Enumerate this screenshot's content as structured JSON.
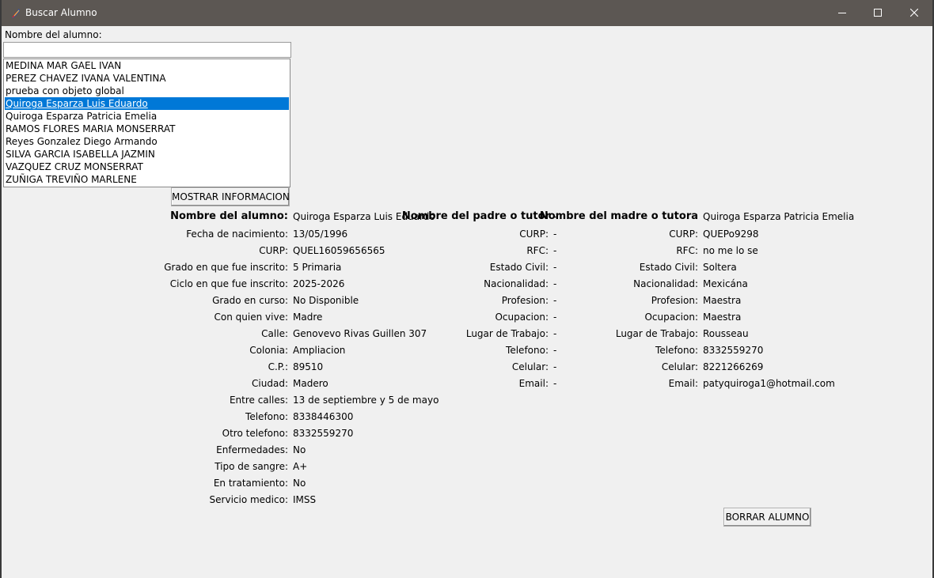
{
  "window": {
    "title": "Buscar Alumno",
    "minimize_icon": "minimize-icon",
    "maximize_icon": "maximize-icon",
    "close_icon": "close-icon",
    "app_icon": "feather-app-icon"
  },
  "search": {
    "label": "Nombre del alumno:",
    "value": ""
  },
  "student_list": {
    "items": [
      "MEDINA MAR GAEL IVAN",
      "PEREZ CHAVEZ IVANA VALENTINA",
      "prueba con objeto global",
      "Quiroga Esparza Luis Eduardo",
      "Quiroga Esparza Patricia Emelia",
      "RAMOS FLORES MARIA MONSERRAT",
      "Reyes Gonzalez Diego Armando",
      "SILVA GARCIA ISABELLA JAZMIN",
      "VAZQUEZ CRUZ MONSERRAT",
      "ZUÑIGA TREVIÑO MARLENE"
    ],
    "selected_index": 3
  },
  "buttons": {
    "show_info": "MOSTRAR INFORMACION",
    "delete_student": "BORRAR ALUMNO"
  },
  "student": {
    "header_label": "Nombre del alumno:",
    "header_value": "Quiroga Esparza Luis Eduardo",
    "fields": [
      {
        "label": "Fecha de nacimiento:",
        "value": "13/05/1996"
      },
      {
        "label": "CURP:",
        "value": "QUEL16059656565"
      },
      {
        "label": "Grado en que fue inscrito:",
        "value": "5 Primaria"
      },
      {
        "label": "Ciclo en que fue inscrito:",
        "value": "2025-2026"
      },
      {
        "label": "Grado en curso:",
        "value": "No Disponible"
      },
      {
        "label": "Con quien vive:",
        "value": "Madre"
      },
      {
        "label": "Calle:",
        "value": "Genovevo Rivas Guillen 307"
      },
      {
        "label": "Colonia:",
        "value": "Ampliacion"
      },
      {
        "label": "C.P.:",
        "value": "89510"
      },
      {
        "label": "Ciudad:",
        "value": "Madero"
      },
      {
        "label": "Entre calles:",
        "value": "13 de septiembre y 5 de mayo"
      },
      {
        "label": "Telefono:",
        "value": "8338446300"
      },
      {
        "label": "Otro telefono:",
        "value": "8332559270"
      },
      {
        "label": "Enfermedades:",
        "value": "No"
      },
      {
        "label": "Tipo de sangre:",
        "value": "A+"
      },
      {
        "label": "En tratamiento:",
        "value": "No"
      },
      {
        "label": "Servicio medico:",
        "value": "IMSS"
      }
    ]
  },
  "father": {
    "header_label": "Nombre del padre o tutor",
    "header_value": "-",
    "fields": [
      {
        "label": "CURP:",
        "value": "-"
      },
      {
        "label": "RFC:",
        "value": "-"
      },
      {
        "label": "Estado Civil:",
        "value": "-"
      },
      {
        "label": "Nacionalidad:",
        "value": "-"
      },
      {
        "label": "Profesion:",
        "value": "-"
      },
      {
        "label": "Ocupacion:",
        "value": "-"
      },
      {
        "label": "Lugar de Trabajo:",
        "value": "-"
      },
      {
        "label": "Telefono:",
        "value": "-"
      },
      {
        "label": "Celular:",
        "value": "-"
      },
      {
        "label": "Email:",
        "value": "-"
      }
    ]
  },
  "mother": {
    "header_label": "Nombre del madre o tutora",
    "header_value": "Quiroga Esparza Patricia Emelia",
    "fields": [
      {
        "label": "CURP:",
        "value": "QUEPo9298"
      },
      {
        "label": "RFC:",
        "value": "no me lo se"
      },
      {
        "label": "Estado Civil:",
        "value": "Soltera"
      },
      {
        "label": "Nacionalidad:",
        "value": "Mexicána"
      },
      {
        "label": "Profesion:",
        "value": "Maestra"
      },
      {
        "label": "Ocupacion:",
        "value": "Maestra"
      },
      {
        "label": "Lugar de Trabajo:",
        "value": "Rousseau"
      },
      {
        "label": "Telefono:",
        "value": "8332559270"
      },
      {
        "label": "Celular:",
        "value": "8221266269"
      },
      {
        "label": "Email:",
        "value": "patyquiroga1@hotmail.com"
      }
    ]
  }
}
